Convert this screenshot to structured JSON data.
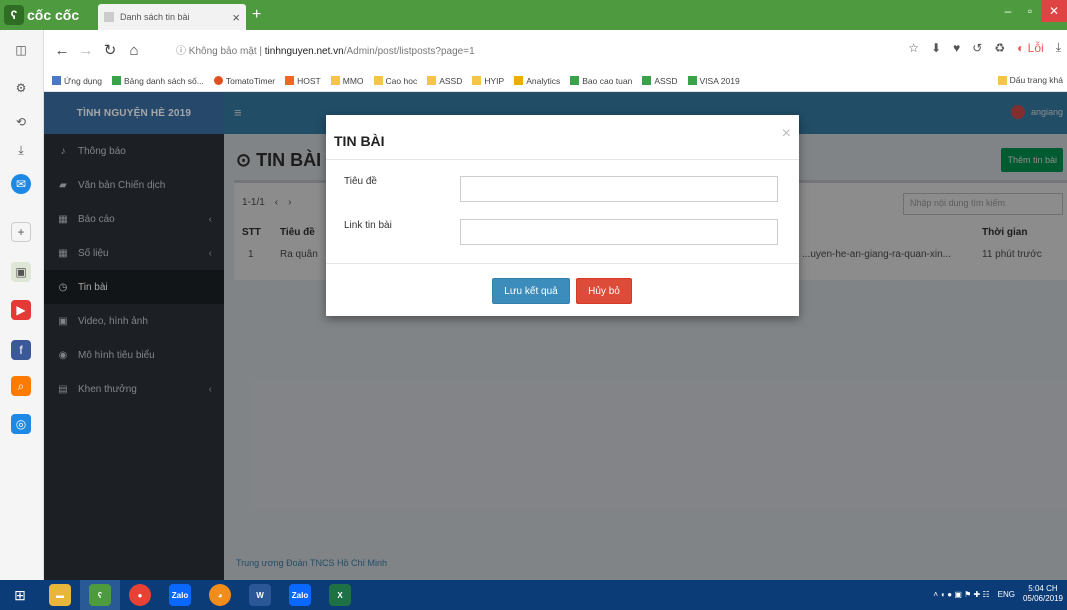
{
  "browser": {
    "brand": "cốc cốc",
    "tab_title": "Danh sách tin bài",
    "url_prefix": "Không bảo mật",
    "url_host": "tinhnguyen.net.vn",
    "url_path": "/Admin/post/listposts?page=1",
    "bookmarks": [
      "Ứng dụng",
      "Bảng danh sách số...",
      "TomatoTimer",
      "HOST",
      "MMO",
      "Cao hoc",
      "ASSD",
      "HYIP",
      "Analytics",
      "Bao cao tuan",
      "ASSD",
      "VISA 2019"
    ],
    "bookmarks_right": "Dấu trang khá",
    "profile_label": "Lỗi"
  },
  "admin": {
    "brand": "TÌNH NGUYỆN HÈ 2019",
    "menu": [
      {
        "label": "Thông báo",
        "icon": "bell-icon",
        "glyph": "🔔",
        "caret": false
      },
      {
        "label": "Văn bản Chiến dịch",
        "icon": "document-icon",
        "glyph": "🖹",
        "caret": false
      },
      {
        "label": "Báo cáo",
        "icon": "calendar-icon",
        "glyph": "▦",
        "caret": true
      },
      {
        "label": "Số liệu",
        "icon": "calendar-icon",
        "glyph": "▦",
        "caret": true
      },
      {
        "label": "Tin bài",
        "icon": "clock-icon",
        "glyph": "◷",
        "caret": false,
        "active": true
      },
      {
        "label": "Video, hình ảnh",
        "icon": "image-icon",
        "glyph": "▣",
        "caret": false
      },
      {
        "label": "Mô hình tiêu biểu",
        "icon": "globe-icon",
        "glyph": "◉",
        "caret": false
      },
      {
        "label": "Khen thưởng",
        "icon": "table-icon",
        "glyph": "▤",
        "caret": true
      }
    ],
    "user": "angiang",
    "page_title": "⊙ TIN BÀI",
    "add_button": "Thêm tin bài",
    "pager": "1-1/1",
    "search_placeholder": "Nhập nội dung tìm kiếm",
    "table": {
      "headers": [
        "STT",
        "Tiêu đề",
        "Thời gian"
      ],
      "row": {
        "stt": "1",
        "title": "Ra quân",
        "link": "...uyen-he-an-giang-ra-quan-xin...",
        "time": "11 phút trước"
      }
    },
    "footer": "Trung ương Đoàn TNCS Hồ Chí Minh"
  },
  "modal": {
    "title": "TIN BÀI",
    "close": "×",
    "label_title": "Tiêu đề",
    "label_link": "Link tin bài",
    "value_title": "",
    "value_link": "",
    "save_label": "Lưu kết quả",
    "cancel_label": "Hủy bỏ"
  },
  "taskbar": {
    "lang": "ENG",
    "time": "5:04 CH",
    "date": "05/06/2019"
  }
}
